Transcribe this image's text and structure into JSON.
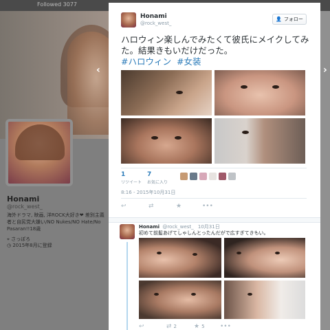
{
  "background": {
    "topbar_stat": "Followed 3077",
    "profile": {
      "name": "Honami",
      "handle": "@rock_west_",
      "bio": "海外ドラマ, 映画, 洋ROCK大好き❤ 差別主義者と自民党大嫌い/NO Nukes/NO Hate/No Pasaran!!18歳",
      "location": "さっぽろ",
      "joined": "2015年8月に登録"
    },
    "nav_prev": "‹",
    "nav_next": "›"
  },
  "tweet": {
    "name": "Honami",
    "handle": "@rock_west_",
    "follow_label": "フォロー",
    "text": "ハロウィン楽しんでみたくて彼氏にメイクしてみた。結果きもいだけだった。",
    "hashtags": [
      "#ハロウィン",
      "#女装"
    ],
    "retweets": {
      "count": "1",
      "label": "リツイート"
    },
    "likes": {
      "count": "7",
      "label": "お気に入り"
    },
    "timestamp": "8:16 - 2015年10月31日",
    "actions": {
      "reply_icon": "reply-icon",
      "retweet_icon": "retweet-icon",
      "like_icon": "star-icon",
      "more_icon": "more-icon"
    }
  },
  "reply": {
    "name": "Honami",
    "handle": "@rock_west_",
    "date": "10月31日",
    "text": "初めて前髪あげてしゃしんとったんだがで広すぎてきもい。",
    "retweet_count": "2",
    "like_count": "5"
  },
  "colors": {
    "link": "#2b7bb9",
    "muted": "#8899a6",
    "thread": "#b4d7ee"
  }
}
